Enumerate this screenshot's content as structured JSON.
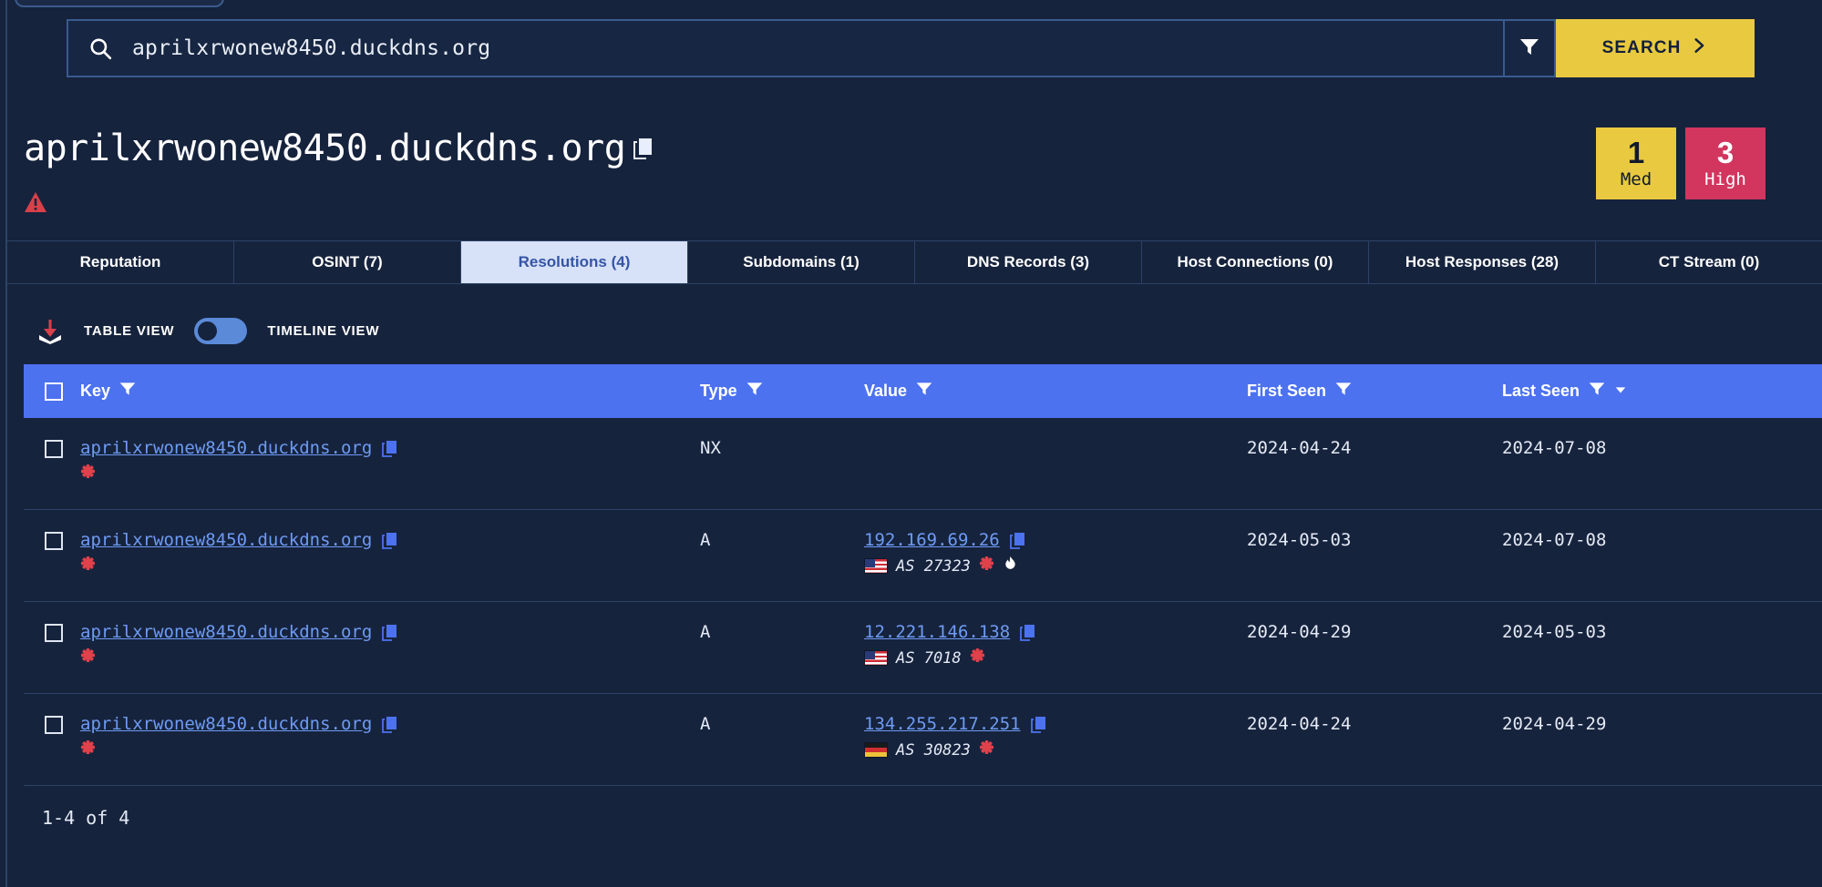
{
  "search": {
    "value": "aprilxrwonew8450.duckdns.org",
    "icon": "search-icon",
    "filter_icon": "filter-icon",
    "submit_label": "SEARCH",
    "submit_chevron": "›"
  },
  "header": {
    "title": "aprilxrwonew8450.duckdns.org",
    "copy_icon": "copy-icon",
    "warning_icon": "warning-triangle-icon",
    "badges": [
      {
        "count": "1",
        "label": "Med",
        "color": "#e9c93f"
      },
      {
        "count": "3",
        "label": "High",
        "color": "#d2355e"
      }
    ]
  },
  "tabs": [
    {
      "label": "Reputation",
      "active": false
    },
    {
      "label": "OSINT (7)",
      "active": false
    },
    {
      "label": "Resolutions (4)",
      "active": true
    },
    {
      "label": "Subdomains (1)",
      "active": false
    },
    {
      "label": "DNS Records (3)",
      "active": false
    },
    {
      "label": "Host Connections (0)",
      "active": false
    },
    {
      "label": "Host Responses (28)",
      "active": false
    },
    {
      "label": "CT Stream (0)",
      "active": false
    }
  ],
  "toolbar": {
    "download_icon": "download-icon",
    "table_view_label": "TABLE VIEW",
    "timeline_view_label": "TIMELINE VIEW",
    "toggle_state": "table"
  },
  "table": {
    "columns": [
      {
        "label": "Key",
        "filter": true,
        "sort": null
      },
      {
        "label": "Type",
        "filter": true,
        "sort": null
      },
      {
        "label": "Value",
        "filter": true,
        "sort": null
      },
      {
        "label": "First Seen",
        "filter": true,
        "sort": null
      },
      {
        "label": "Last Seen",
        "filter": true,
        "sort": "desc"
      }
    ],
    "rows": [
      {
        "key": "aprilxrwonew8450.duckdns.org",
        "key_badge": "malicious-asterisk-icon",
        "type": "NX",
        "value": "",
        "value_flag": "",
        "value_asn": "",
        "value_badges": [],
        "first_seen": "2024-04-24",
        "last_seen": "2024-07-08"
      },
      {
        "key": "aprilxrwonew8450.duckdns.org",
        "key_badge": "malicious-asterisk-icon",
        "type": "A",
        "value": "192.169.69.26",
        "value_flag": "us",
        "value_asn": "AS 27323",
        "value_badges": [
          "malicious-asterisk-icon",
          "flame-icon"
        ],
        "first_seen": "2024-05-03",
        "last_seen": "2024-07-08"
      },
      {
        "key": "aprilxrwonew8450.duckdns.org",
        "key_badge": "malicious-asterisk-icon",
        "type": "A",
        "value": "12.221.146.138",
        "value_flag": "us",
        "value_asn": "AS 7018",
        "value_badges": [
          "malicious-asterisk-icon"
        ],
        "first_seen": "2024-04-29",
        "last_seen": "2024-05-03"
      },
      {
        "key": "aprilxrwonew8450.duckdns.org",
        "key_badge": "malicious-asterisk-icon",
        "type": "A",
        "value": "134.255.217.251",
        "value_flag": "de",
        "value_asn": "AS 30823",
        "value_badges": [
          "malicious-asterisk-icon"
        ],
        "first_seen": "2024-04-24",
        "last_seen": "2024-04-29"
      }
    ],
    "pagination": "1-4 of 4"
  },
  "colors": {
    "background": "#16233d",
    "accent_yellow": "#e9c93f",
    "accent_red": "#d2355e",
    "header_blue": "#4c72f0",
    "link_blue": "#6e9bf3",
    "active_tab_bg": "#d7e1f8"
  }
}
